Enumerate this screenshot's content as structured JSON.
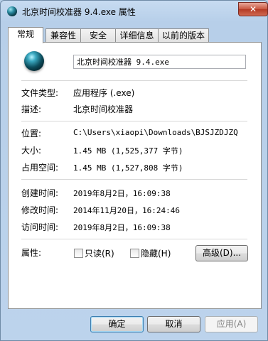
{
  "window": {
    "title": "北京时间校准器 9.4.exe 属性",
    "close_glyph": "✕"
  },
  "tabs": [
    "常规",
    "兼容性",
    "安全",
    "详细信息",
    "以前的版本"
  ],
  "general": {
    "file_name": "北京时间校准器 9.4.exe",
    "rows": [
      {
        "label": "文件类型:",
        "value": "应用程序 (.exe)"
      },
      {
        "label": "描述:",
        "value": "北京时间校准器"
      },
      {
        "label": "位置:",
        "value": "C:\\Users\\xiaopi\\Downloads\\BJSJZDJZQ"
      },
      {
        "label": "大小:",
        "value": "1.45 MB (1,525,377 字节)"
      },
      {
        "label": "占用空间:",
        "value": "1.45 MB (1,527,808 字节)"
      },
      {
        "label": "创建时间:",
        "value": "2019年8月2日，16:09:38"
      },
      {
        "label": "修改时间:",
        "value": "2014年11月20日，16:24:46"
      },
      {
        "label": "访问时间:",
        "value": "2019年8月2日，16:09:38"
      }
    ],
    "attributes": {
      "label": "属性:",
      "readonly": "只读(R)",
      "hidden": "隐藏(H)",
      "advanced": "高级(D)..."
    }
  },
  "buttons": {
    "ok": "确定",
    "cancel": "取消",
    "apply": "应用(A)"
  }
}
